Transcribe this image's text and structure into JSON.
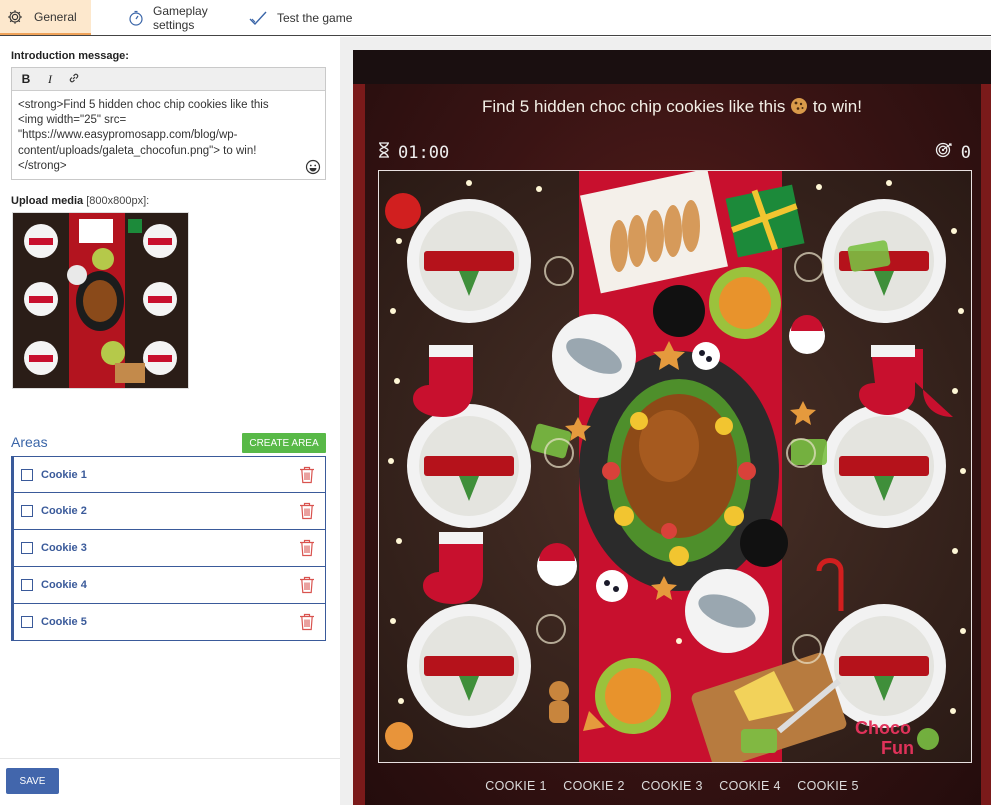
{
  "tabs": [
    {
      "label": "General",
      "icon": "gear-icon",
      "active": true
    },
    {
      "label": "Gameplay settings",
      "icon": "stopwatch-icon",
      "active": false
    },
    {
      "label": "Test the game",
      "icon": "check-icon",
      "active": false
    }
  ],
  "intro": {
    "label": "Introduction message:",
    "toolbar": {
      "bold": "B",
      "italic": "I"
    },
    "text": "<strong>Find 5 hidden choc chip cookies like this\n<img width=\"25\" src=\n\"https://www.easypromosapp.com/blog/wp-\ncontent/uploads/galeta_chocofun.png\"> to win!\n</strong>"
  },
  "upload": {
    "label": "Upload media",
    "hint": "[800x800px]:"
  },
  "areas": {
    "title": "Areas",
    "create_label": "CREATE AREA",
    "items": [
      "Cookie 1",
      "Cookie 2",
      "Cookie 3",
      "Cookie 4",
      "Cookie 5"
    ]
  },
  "save_label": "SAVE",
  "preview": {
    "title": "Find 5 hidden choc chip cookies like this",
    "title_suffix": "to win!",
    "timer": "01:00",
    "found": "0",
    "cookie_labels": [
      "COOKIE 1",
      "COOKIE 2",
      "COOKIE 3",
      "COOKIE 4",
      "COOKIE 5"
    ],
    "brand_line1": "Choco",
    "brand_line2": "Fun"
  },
  "colors": {
    "tab_active_bg": "#fde8cd",
    "tab_active_border": "#f0a35a",
    "areas_blue": "#3a5a9a",
    "create_green": "#58b947",
    "save_blue": "#4266ac",
    "delete_red": "#d9534f",
    "runner_red": "#c8102e"
  }
}
